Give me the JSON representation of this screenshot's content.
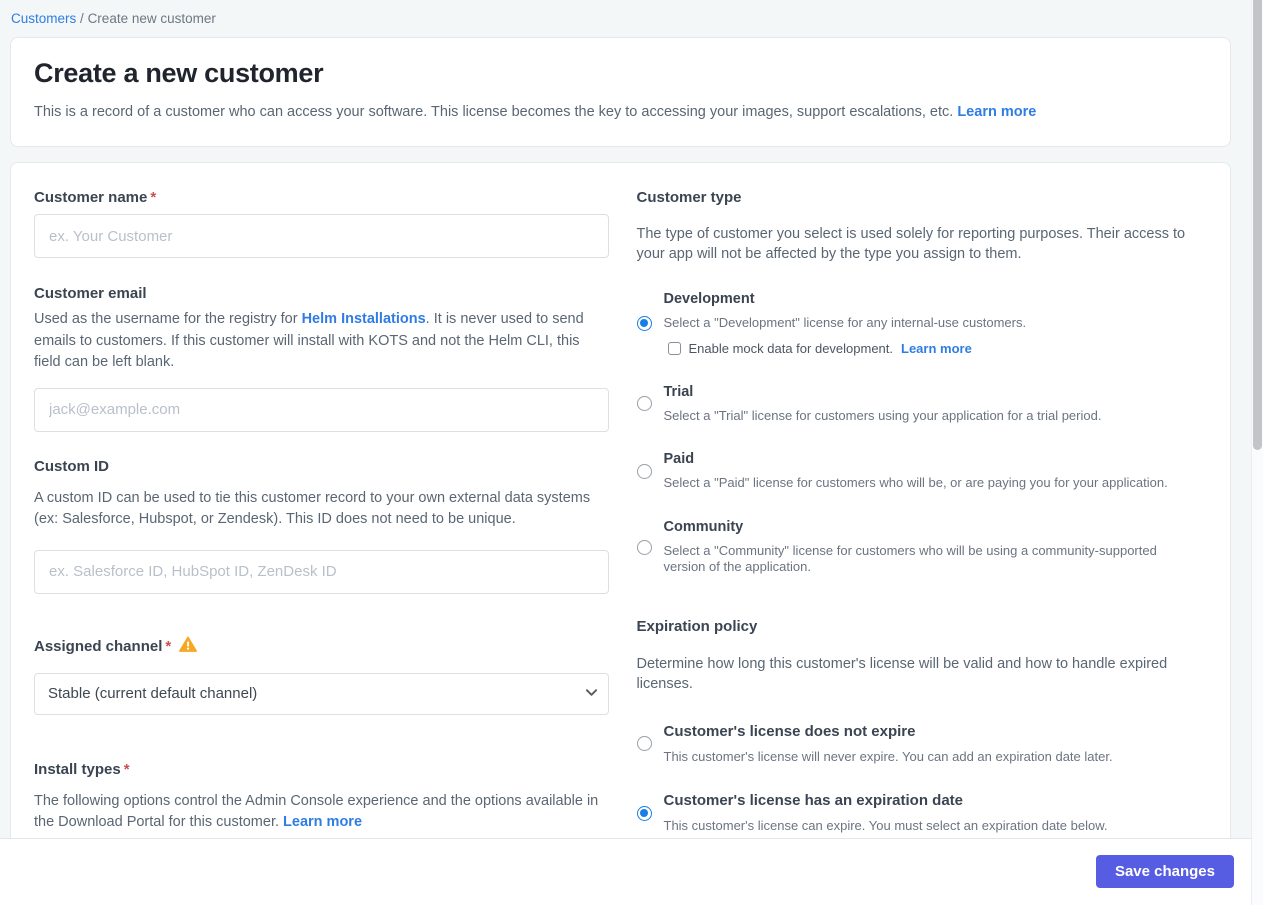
{
  "breadcrumb": {
    "link": "Customers",
    "separator": "/",
    "current": "Create new customer"
  },
  "header": {
    "title": "Create a new customer",
    "description": "This is a record of a customer who can access your software. This license becomes the key to accessing your images, support escalations, etc.",
    "learn_more": "Learn more"
  },
  "form": {
    "customer_name": {
      "label": "Customer name",
      "required": "*",
      "placeholder": "ex. Your Customer"
    },
    "customer_email": {
      "label": "Customer email",
      "desc_before": "Used as the username for the registry for ",
      "desc_link": "Helm Installations",
      "desc_after": ". It is never used to send emails to customers. If this customer will install with KOTS and not the Helm CLI, this field can be left blank.",
      "placeholder": "jack@example.com"
    },
    "custom_id": {
      "label": "Custom ID",
      "description": "A custom ID can be used to tie this customer record to your own external data systems (ex: Salesforce, Hubspot, or Zendesk). This ID does not need to be unique.",
      "placeholder": "ex. Salesforce ID, HubSpot ID, ZenDesk ID"
    },
    "assigned_channel": {
      "label": "Assigned channel",
      "required": "*",
      "selected": "Stable (current default channel)"
    },
    "install_types": {
      "label": "Install types",
      "required": "*",
      "description": "The following options control the Admin Console experience and the options available in the Download Portal for this customer.",
      "learn_more": "Learn more"
    }
  },
  "customer_type": {
    "heading": "Customer type",
    "description": "The type of customer you select is used solely for reporting purposes. Their access to your app will not be affected by the type you assign to them.",
    "options": [
      {
        "title": "Development",
        "description": "Select a \"Development\" license for any internal-use customers.",
        "selected": true,
        "checkbox": {
          "label": "Enable mock data for development.",
          "learn_more": "Learn more",
          "checked": false
        }
      },
      {
        "title": "Trial",
        "description": "Select a \"Trial\" license for customers using your application for a trial period.",
        "selected": false
      },
      {
        "title": "Paid",
        "description": "Select a \"Paid\" license for customers who will be, or are paying you for your application.",
        "selected": false
      },
      {
        "title": "Community",
        "description": "Select a \"Community\" license for customers who will be using a community-supported version of the application.",
        "selected": false
      }
    ]
  },
  "expiration_policy": {
    "heading": "Expiration policy",
    "description": "Determine how long this customer's license will be valid and how to handle expired licenses.",
    "options": [
      {
        "title": "Customer's license does not expire",
        "description": "This customer's license will never expire. You can add an expiration date later.",
        "selected": false
      },
      {
        "title": "Customer's license has an expiration date",
        "description": "This customer's license can expire. You must select an expiration date below.",
        "selected": true
      }
    ]
  },
  "footer": {
    "save_label": "Save changes"
  },
  "colors": {
    "link": "#2f7de4",
    "radio": "#1a7ee6",
    "save": "#575de2",
    "warning": "#f7a823",
    "required": "#c8504e"
  }
}
